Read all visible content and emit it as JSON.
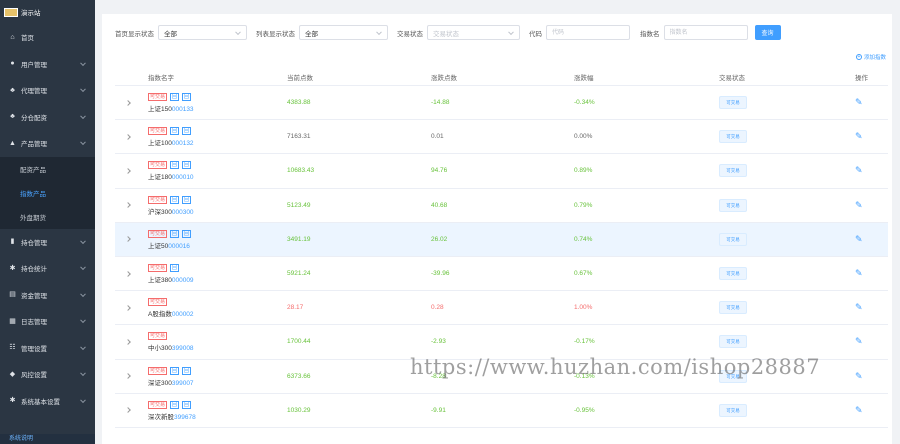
{
  "app": {
    "title": "演示站"
  },
  "sidebar": {
    "items": [
      {
        "label": "首页",
        "icon": "home-icon"
      },
      {
        "label": "用户管理",
        "icon": "user-icon",
        "expandable": true
      },
      {
        "label": "代理管理",
        "icon": "org-icon",
        "expandable": true
      },
      {
        "label": "分仓配资",
        "icon": "org-icon",
        "expandable": true
      },
      {
        "label": "产品管理",
        "icon": "product-icon",
        "expandable": true
      }
    ],
    "submenu": [
      {
        "label": "配资产品",
        "active": false
      },
      {
        "label": "指数产品",
        "active": true
      },
      {
        "label": "外盘期货",
        "active": false
      }
    ],
    "items_after": [
      {
        "label": "持仓管理",
        "icon": "chart-icon",
        "expandable": true
      },
      {
        "label": "持仓统计",
        "icon": "gear-icon",
        "expandable": true
      },
      {
        "label": "资金管理",
        "icon": "wallet-icon",
        "expandable": true
      },
      {
        "label": "日志管理",
        "icon": "log-icon",
        "expandable": true
      },
      {
        "label": "管理设置",
        "icon": "settings-icon",
        "expandable": true
      },
      {
        "label": "风控设置",
        "icon": "shield-icon",
        "expandable": true
      },
      {
        "label": "系统基本设置",
        "icon": "gear-icon",
        "expandable": true
      }
    ],
    "bottom": "系统说明"
  },
  "filters": {
    "home_display_label": "首页显示状态",
    "home_display_value": "全部",
    "list_display_label": "列表显示状态",
    "list_display_value": "全部",
    "trade_status_label": "交易状态",
    "trade_status_placeholder": "交易状态",
    "code_label": "代码",
    "code_placeholder": "代码",
    "index_name_label": "指数名",
    "index_name_placeholder": "指数名",
    "query_label": "查询"
  },
  "add_link": "添加指数",
  "table": {
    "headers": {
      "name": "指数名字",
      "current": "当前点数",
      "change": "涨跌点数",
      "pct": "涨跌幅",
      "status": "交易状态",
      "op": "操作"
    },
    "tag_red": "可交易",
    "tag_blue": "回",
    "rows": [
      {
        "name": "上证150",
        "code": "000133",
        "current": "4383.88",
        "change": "-14.88",
        "pct": "-0.34%",
        "trend": "down",
        "status": "可交易",
        "tags": 3
      },
      {
        "name": "上证100",
        "code": "000132",
        "current": "7163.31",
        "change": "0.01",
        "pct": "0.00%",
        "trend": "flat",
        "status": "可交易",
        "tags": 3
      },
      {
        "name": "上证180",
        "code": "000010",
        "current": "10683.43",
        "change": "94.76",
        "pct": "0.89%",
        "trend": "down",
        "status": "可交易",
        "tags": 3
      },
      {
        "name": "沪深300",
        "code": "000300",
        "current": "5123.49",
        "change": "40.68",
        "pct": "0.79%",
        "trend": "down",
        "status": "可交易",
        "tags": 3
      },
      {
        "name": "上证50",
        "code": "000016",
        "current": "3491.19",
        "change": "26.02",
        "pct": "0.74%",
        "trend": "down",
        "status": "可交易",
        "tags": 3,
        "highlight": true
      },
      {
        "name": "上证380",
        "code": "000009",
        "current": "5921.24",
        "change": "-39.96",
        "pct": "0.67%",
        "trend": "down",
        "status": "可交易",
        "tags": 2
      },
      {
        "name": "A股指数",
        "code": "000002",
        "current": "28.17",
        "change": "0.28",
        "pct": "1.00%",
        "trend": "up",
        "status": "可交易",
        "tags": 1
      },
      {
        "name": "中小300",
        "code": "399008",
        "current": "1700.44",
        "change": "-2.93",
        "pct": "-0.17%",
        "trend": "down",
        "status": "可交易",
        "tags": 1
      },
      {
        "name": "深证300",
        "code": "399007",
        "current": "6373.66",
        "change": "-8.28",
        "pct": "-0.13%",
        "trend": "down",
        "status": "可交易",
        "tags": 3
      },
      {
        "name": "深次新股",
        "code": "399678",
        "current": "1030.29",
        "change": "-9.91",
        "pct": "-0.95%",
        "trend": "down",
        "status": "可交易",
        "tags": 3
      }
    ]
  },
  "watermark": "https://www.huzhan.com/ishop28887"
}
